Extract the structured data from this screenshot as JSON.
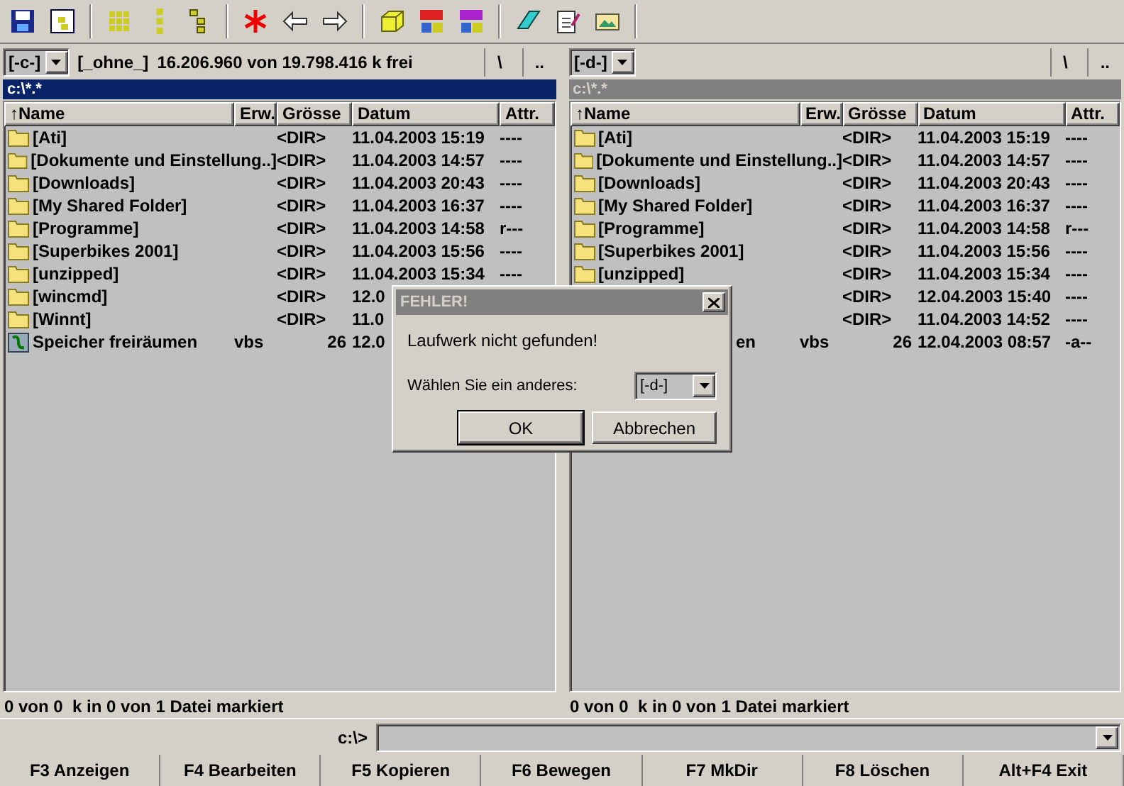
{
  "panels": [
    {
      "drive": "[-c-]",
      "volume_label": "[_ohne_]",
      "free_space": "16.206.960 von 19.798.416 k frei",
      "root_button": "\\",
      "parent_button": "..",
      "path": "c:\\*.*",
      "active": true,
      "columns": [
        "↑Name",
        "Erw.",
        "Grösse",
        "Datum",
        "Attr."
      ],
      "rows": [
        {
          "kind": "folder",
          "name": "[Ati]",
          "size": "<DIR>",
          "date": "11.04.2003 15:19",
          "attr": "----"
        },
        {
          "kind": "folder",
          "name": "[Dokumente und Einstellung..]",
          "size": "<DIR>",
          "date": "11.04.2003 14:57",
          "attr": "----"
        },
        {
          "kind": "folder",
          "name": "[Downloads]",
          "size": "<DIR>",
          "date": "11.04.2003 20:43",
          "attr": "----"
        },
        {
          "kind": "folder",
          "name": "[My Shared Folder]",
          "size": "<DIR>",
          "date": "11.04.2003 16:37",
          "attr": "----"
        },
        {
          "kind": "folder",
          "name": "[Programme]",
          "size": "<DIR>",
          "date": "11.04.2003 14:58",
          "attr": "r---"
        },
        {
          "kind": "folder",
          "name": "[Superbikes 2001]",
          "size": "<DIR>",
          "date": "11.04.2003 15:56",
          "attr": "----"
        },
        {
          "kind": "folder",
          "name": "[unzipped]",
          "size": "<DIR>",
          "date": "11.04.2003 15:34",
          "attr": "----"
        },
        {
          "kind": "folder",
          "name": "[wincmd]",
          "size": "<DIR>",
          "date": "12.0"
        },
        {
          "kind": "folder",
          "name": "[Winnt]",
          "size": "<DIR>",
          "date": "11.0"
        },
        {
          "kind": "script",
          "name": "Speicher freiräumen",
          "ext": "vbs",
          "size": "26",
          "date": "12.0"
        }
      ],
      "status": "0 von 0  k in 0 von 1 Datei markiert"
    },
    {
      "drive": "[-d-]",
      "root_button": "\\",
      "parent_button": "..",
      "path": "c:\\*.*",
      "active": false,
      "columns": [
        "↑Name",
        "Erw.",
        "Grösse",
        "Datum",
        "Attr."
      ],
      "rows": [
        {
          "kind": "folder",
          "name": "[Ati]",
          "size": "<DIR>",
          "date": "11.04.2003 15:19",
          "attr": "----"
        },
        {
          "kind": "folder",
          "name": "[Dokumente und Einstellung..]",
          "size": "<DIR>",
          "date": "11.04.2003 14:57",
          "attr": "----"
        },
        {
          "kind": "folder",
          "name": "[Downloads]",
          "size": "<DIR>",
          "date": "11.04.2003 20:43",
          "attr": "----"
        },
        {
          "kind": "folder",
          "name": "[My Shared Folder]",
          "size": "<DIR>",
          "date": "11.04.2003 16:37",
          "attr": "----"
        },
        {
          "kind": "folder",
          "name": "[Programme]",
          "size": "<DIR>",
          "date": "11.04.2003 14:58",
          "attr": "r---"
        },
        {
          "kind": "folder",
          "name": "[Superbikes 2001]",
          "size": "<DIR>",
          "date": "11.04.2003 15:56",
          "attr": "----"
        },
        {
          "kind": "folder",
          "name": "[unzipped]",
          "size": "<DIR>",
          "date": "11.04.2003 15:34",
          "attr": "----"
        },
        {
          "kind": "hidden",
          "size": "<DIR>",
          "date": "12.04.2003 15:40",
          "attr": "----"
        },
        {
          "kind": "hidden",
          "size": "<DIR>",
          "date": "11.04.2003 14:52",
          "attr": "----"
        },
        {
          "kind": "hidden",
          "name": "en",
          "ext": "vbs",
          "size": "26",
          "date": "12.04.2003 08:57",
          "attr": "-a--"
        }
      ],
      "status": "0 von 0  k in 0 von 1 Datei markiert"
    }
  ],
  "command_line": {
    "prompt": "c:\\>"
  },
  "function_keys": [
    "F3 Anzeigen",
    "F4 Bearbeiten",
    "F5 Kopieren",
    "F6 Bewegen",
    "F7 MkDir",
    "F8 Löschen",
    "Alt+F4 Exit"
  ],
  "dialog": {
    "title": "FEHLER!",
    "message": "Laufwerk nicht gefunden!",
    "prompt": "Wählen Sie ein anderes:",
    "drive": "[-d-]",
    "buttons": [
      {
        "label": "OK",
        "default": true
      },
      {
        "label": "Abbrechen",
        "default": false
      }
    ]
  }
}
